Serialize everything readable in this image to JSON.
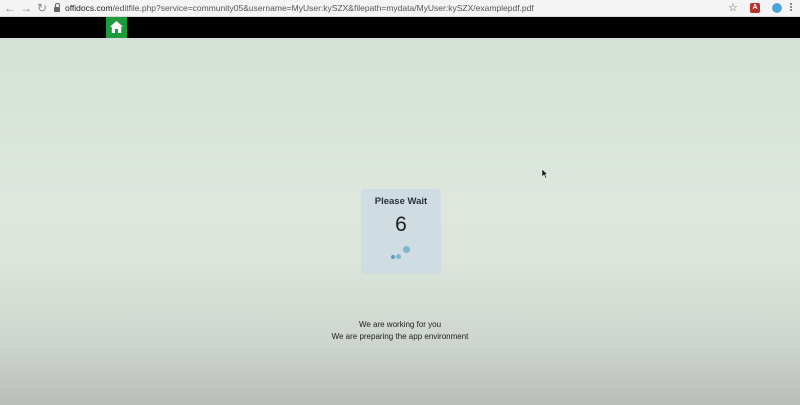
{
  "browser": {
    "url_host": "offidocs.com",
    "url_path": "/editfile.php?service=community05&username=MyUser:kySZX&filepath=mydata/MyUser:kySZX/examplepdf.pdf",
    "nav_back_icon": "arrow-left-icon",
    "nav_forward_icon": "arrow-right-icon",
    "reload_icon": "reload-icon",
    "extension_label": "A"
  },
  "app": {
    "home_icon": "home-icon",
    "home_color": "#1c9a3c"
  },
  "wait_card": {
    "title": "Please Wait",
    "countdown": "6"
  },
  "messages": {
    "line1": "We are working for you",
    "line2": "We are preparing the app environment"
  }
}
